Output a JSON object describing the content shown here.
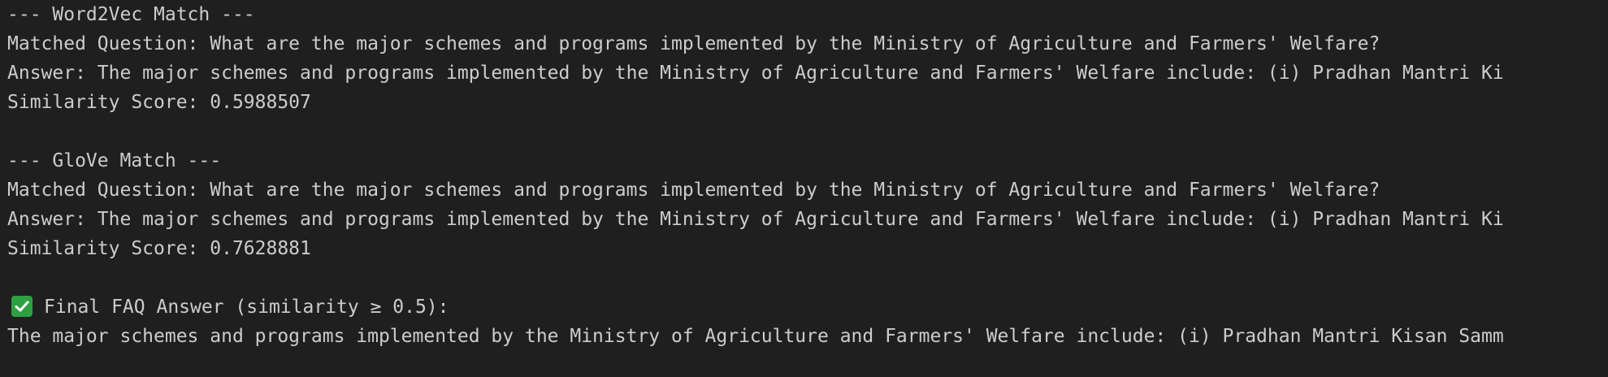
{
  "word2vec": {
    "header": "--- Word2Vec Match ---",
    "question": "Matched Question: What are the major schemes and programs implemented by the Ministry of Agriculture and Farmers' Welfare?",
    "answer": "Answer: The major schemes and programs implemented by the Ministry of Agriculture and Farmers' Welfare include: (i) Pradhan Mantri Ki",
    "score": "Similarity Score: 0.5988507"
  },
  "glove": {
    "header": "--- GloVe Match ---",
    "question": "Matched Question: What are the major schemes and programs implemented by the Ministry of Agriculture and Farmers' Welfare?",
    "answer": "Answer: The major schemes and programs implemented by the Ministry of Agriculture and Farmers' Welfare include: (i) Pradhan Mantri Ki",
    "score": "Similarity Score: 0.7628881"
  },
  "final": {
    "icon": "check-mark-icon",
    "icon_color": "#2ea043",
    "header": "Final FAQ Answer (similarity ≥ 0.5):",
    "answer": "The major schemes and programs implemented by the Ministry of Agriculture and Farmers' Welfare include: (i) Pradhan Mantri Kisan Samm"
  }
}
